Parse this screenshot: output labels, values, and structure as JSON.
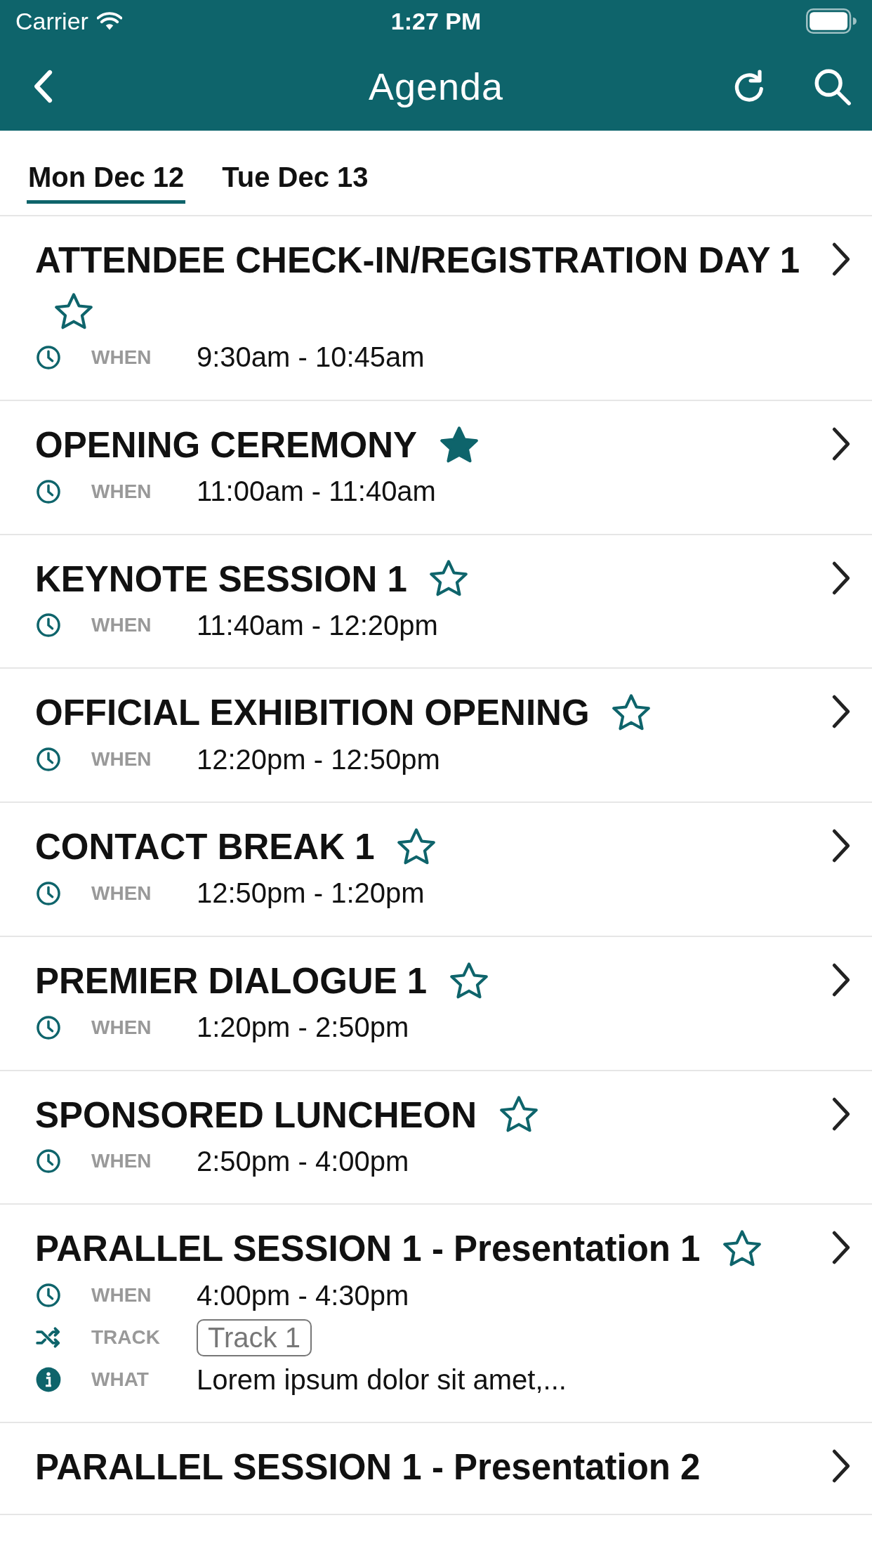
{
  "status_bar": {
    "carrier": "Carrier",
    "time": "1:27 PM"
  },
  "nav_bar": {
    "title": "Agenda"
  },
  "tabs": [
    {
      "label": "Mon Dec 12",
      "selected": true
    },
    {
      "label": "Tue Dec 13",
      "selected": false
    }
  ],
  "sessions": [
    {
      "title": "ATTENDEE CHECK-IN/REGISTRATION DAY 1",
      "starred": false,
      "details": [
        {
          "kind": "when",
          "label": "WHEN",
          "value": "9:30am - 10:45am"
        }
      ]
    },
    {
      "title": "OPENING CEREMONY",
      "starred": true,
      "details": [
        {
          "kind": "when",
          "label": "WHEN",
          "value": "11:00am - 11:40am"
        }
      ]
    },
    {
      "title": "KEYNOTE SESSION 1",
      "starred": false,
      "details": [
        {
          "kind": "when",
          "label": "WHEN",
          "value": "11:40am - 12:20pm"
        }
      ]
    },
    {
      "title": "OFFICIAL EXHIBITION OPENING",
      "starred": false,
      "details": [
        {
          "kind": "when",
          "label": "WHEN",
          "value": "12:20pm - 12:50pm"
        }
      ]
    },
    {
      "title": "CONTACT BREAK 1",
      "starred": false,
      "details": [
        {
          "kind": "when",
          "label": "WHEN",
          "value": "12:50pm - 1:20pm"
        }
      ]
    },
    {
      "title": "PREMIER DIALOGUE 1",
      "starred": false,
      "details": [
        {
          "kind": "when",
          "label": "WHEN",
          "value": "1:20pm - 2:50pm"
        }
      ]
    },
    {
      "title": "SPONSORED LUNCHEON",
      "starred": false,
      "details": [
        {
          "kind": "when",
          "label": "WHEN",
          "value": "2:50pm - 4:00pm"
        }
      ]
    },
    {
      "title": "PARALLEL SESSION 1 - Presentation 1",
      "starred": false,
      "details": [
        {
          "kind": "when",
          "label": "WHEN",
          "value": "4:00pm - 4:30pm"
        },
        {
          "kind": "track",
          "label": "TRACK",
          "value": "Track 1"
        },
        {
          "kind": "what",
          "label": "WHAT",
          "value": "Lorem ipsum dolor sit amet,..."
        }
      ]
    },
    {
      "title": "PARALLEL SESSION 1 - Presentation 2"
    }
  ]
}
